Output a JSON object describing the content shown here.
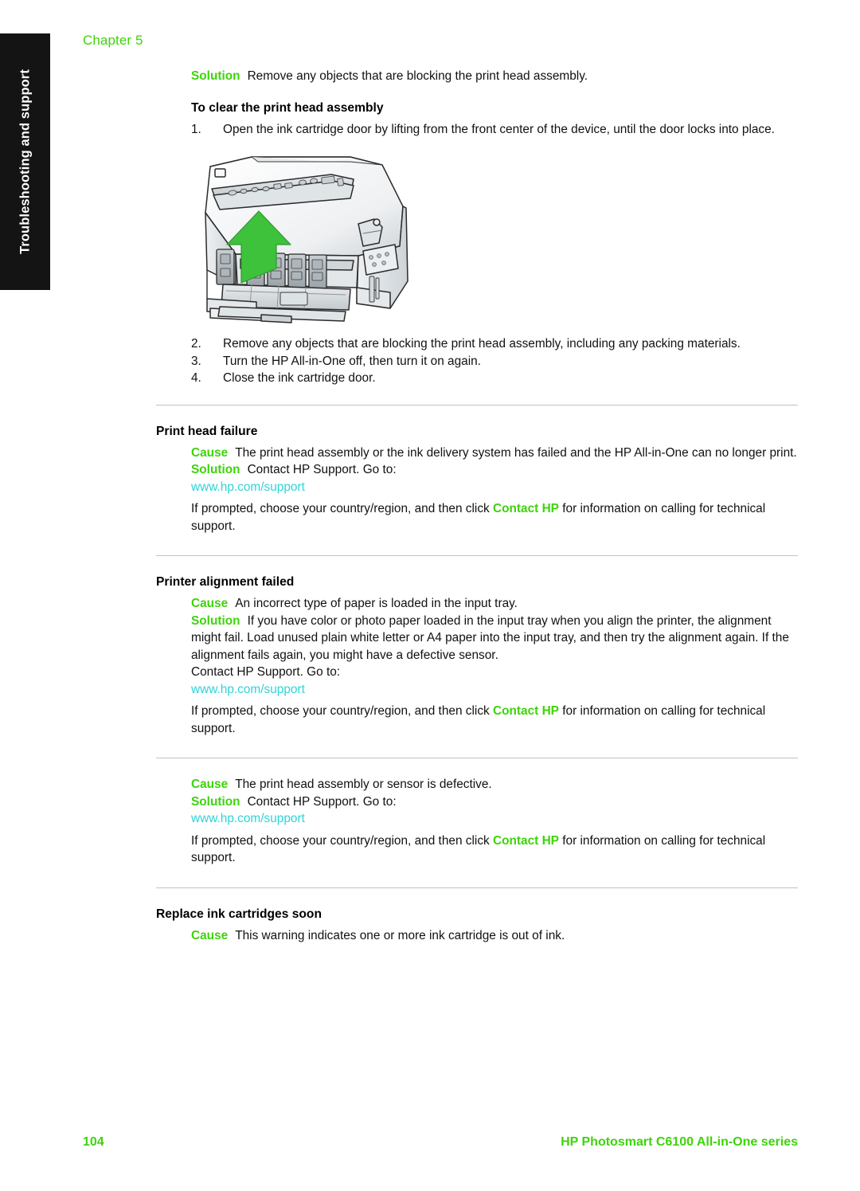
{
  "page": {
    "chapter_label": "Chapter 5",
    "side_tab_label": "Troubleshooting and support",
    "accent_green": "#3dd40a",
    "link_color": "#2fd3d8",
    "tab_background": "#141414",
    "divider_color": "#c2c2c6"
  },
  "intro": {
    "solution_label": "Solution",
    "solution_text": "Remove any objects that are blocking the print head assembly."
  },
  "procedure": {
    "title": "To clear the print head assembly",
    "steps": [
      {
        "num": "1.",
        "text": "Open the ink cartridge door by lifting from the front center of the device, until the door locks into place."
      },
      {
        "num": "2.",
        "text": "Remove any objects that are blocking the print head assembly, including any packing materials."
      },
      {
        "num": "3.",
        "text": "Turn the HP All-in-One off, then turn it on again."
      },
      {
        "num": "4.",
        "text": "Close the ink cartridge door."
      }
    ]
  },
  "figure": {
    "caption": "Line drawing of HP All-in-One printer with ink cartridge door open and green upward arrow"
  },
  "sections": [
    {
      "title": "Print head failure",
      "cause_label": "Cause",
      "cause_text": "The print head assembly or the ink delivery system has failed and the HP All-in-One can no longer print.",
      "solution_label": "Solution",
      "solution_text": "Contact HP Support. Go to:",
      "link": "www.hp.com/support",
      "prompt_pre": "If prompted, choose your country/region, and then click ",
      "prompt_link": "Contact HP",
      "prompt_post": " for information on calling for technical support."
    },
    {
      "title": "Printer alignment failed",
      "cause_label": "Cause",
      "cause_text": "An incorrect type of paper is loaded in the input tray.",
      "solution_label": "Solution",
      "solution_text": "If you have color or photo paper loaded in the input tray when you align the printer, the alignment might fail. Load unused plain white letter or A4 paper into the input tray, and then try the alignment again. If the alignment fails again, you might have a defective sensor.",
      "solution_text2": "Contact HP Support. Go to:",
      "link": "www.hp.com/support",
      "prompt_pre": "If prompted, choose your country/region, and then click ",
      "prompt_link": "Contact HP",
      "prompt_post": " for information on calling for technical support."
    },
    {
      "title": "",
      "cause_label": "Cause",
      "cause_text": "The print head assembly or sensor is defective.",
      "solution_label": "Solution",
      "solution_text": "Contact HP Support. Go to:",
      "link": "www.hp.com/support",
      "prompt_pre": "If prompted, choose your country/region, and then click ",
      "prompt_link": "Contact HP",
      "prompt_post": " for information on calling for technical support."
    },
    {
      "title": "Replace ink cartridges soon",
      "cause_label": "Cause",
      "cause_text": "This warning indicates one or more ink cartridge is out of ink.",
      "solution_label": "",
      "solution_text": "",
      "link": "",
      "prompt_pre": "",
      "prompt_link": "",
      "prompt_post": ""
    }
  ],
  "footer": {
    "page_number": "104",
    "product": "HP Photosmart C6100 All-in-One series"
  }
}
